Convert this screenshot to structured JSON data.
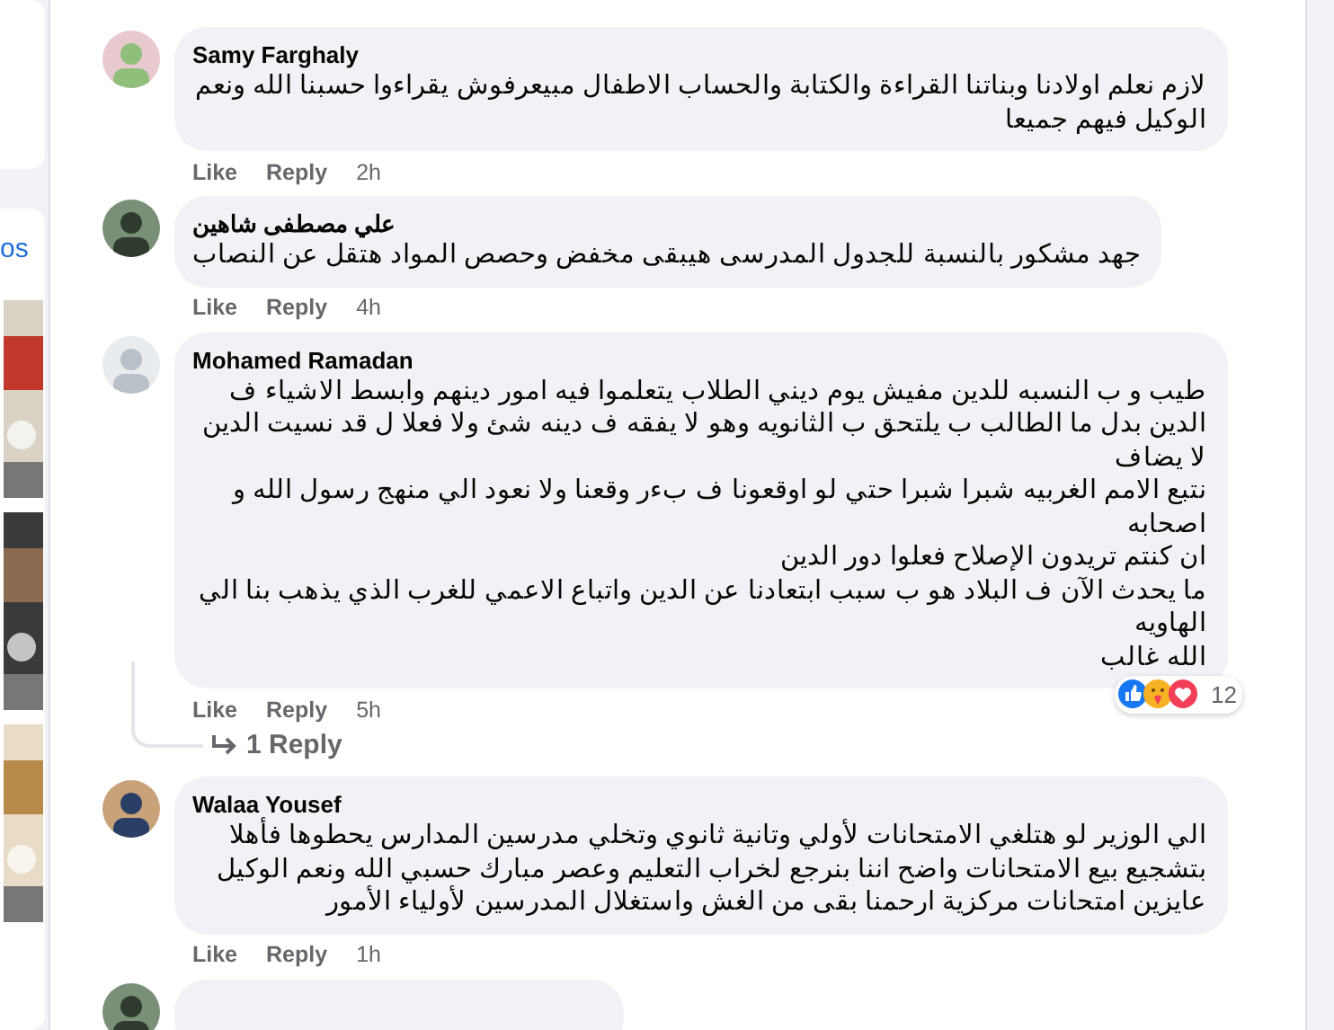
{
  "sidebar": {
    "link_text": "os"
  },
  "comments": [
    {
      "author": "Samy Farghaly",
      "text": "لازم نعلم اولادنا وبناتنا القراءة والكتابة والحساب الاطفال مبيعرفوش يقراءوا حسبنا الله ونعم الوكيل فيهم جميعا",
      "like": "Like",
      "reply": "Reply",
      "time": "2h"
    },
    {
      "author": "علي مصطفى شاهين",
      "text": "جهد مشكور بالنسبة للجدول المدرسى هيبقى مخفض وحصص المواد هتقل عن النصاب",
      "like": "Like",
      "reply": "Reply",
      "time": "4h"
    },
    {
      "author": "Mohamed Ramadan",
      "text": "طيب و ب النسبه للدين مفيش يوم ديني الطلاب يتعلموا فيه امور دينهم وابسط الاشياء ف الدين بدل ما الطالب ب يلتحق ب الثانويه وهو لا يفقه ف دينه شئ ولا فعلا ل قد نسيت الدين لا يضاف\nنتبع الامم الغربيه شبرا شبرا حتي لو اوقعونا ف بءر وقعنا ولا نعود الي منهج رسول الله و اصحابه\nان كنتم تريدون الإصلاح فعلوا دور الدين\nما يحدث الآن ف البلاد هو ب سبب ابتعادنا عن الدين واتباع الاعمي للغرب الذي يذهب بنا الي الهاويه\nالله غالب",
      "like": "Like",
      "reply": "Reply",
      "time": "5h",
      "reaction_count": "12",
      "replies_link": "1 Reply"
    },
    {
      "author": "Walaa Yousef",
      "text": "الي الوزير لو هتلغي الامتحانات لأولي وتانية ثانوي وتخلي مدرسين المدارس يحطوها فأهلا بتشجيع بيع الامتحانات واضح اننا بنرجع لخراب التعليم وعصر مبارك حسبي الله ونعم الوكيل عايزين امتحانات مركزية ارحمنا بقى من الغش واستغلال المدرسين لأولياء الأمور",
      "like": "Like",
      "reply": "Reply",
      "time": "1h"
    }
  ]
}
